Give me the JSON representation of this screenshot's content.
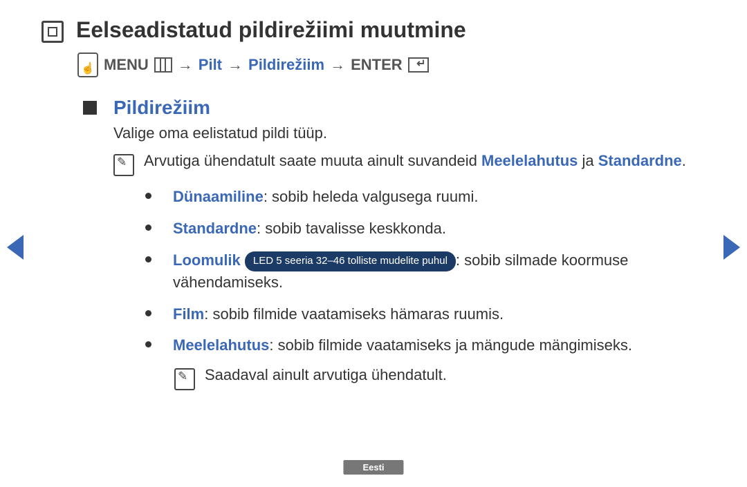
{
  "title": "Eelseadistatud pildirežiimi muutmine",
  "path": {
    "menu_label": "MENU",
    "link1": "Pilt",
    "link2": "Pildirežiim",
    "enter_label": "ENTER",
    "arrow": "→"
  },
  "section_title": "Pildirežiim",
  "intro": "Valige oma eelistatud pildi tüüp.",
  "note1_a": "Arvutiga ühendatult saate muuta ainult suvandeid ",
  "note1_link1": "Meelelahutus",
  "note1_b": " ja ",
  "note1_link2": "Standardne",
  "note1_c": ".",
  "options": [
    {
      "name": "Dünaamiline",
      "sep": ":  ",
      "text": "sobib heleda valgusega ruumi."
    },
    {
      "name": "Standardne",
      "sep": ":  ",
      "text": "sobib tavalisse keskkonda."
    },
    {
      "name": "Loomulik",
      "sep": " ",
      "pill": "LED 5 seeria 32–46 tolliste mudelite puhul",
      "after_pill": ": sobib silmade koormuse vähendamiseks."
    },
    {
      "name": "Film",
      "sep": ":  ",
      "text": "sobib filmide vaatamiseks hämaras ruumis."
    },
    {
      "name": "Meelelahutus",
      "sep": ": ",
      "text": "sobib filmide vaatamiseks ja mängude mängimiseks."
    }
  ],
  "note2": "Saadaval ainult arvutiga ühendatult.",
  "footer_lang": "Eesti"
}
